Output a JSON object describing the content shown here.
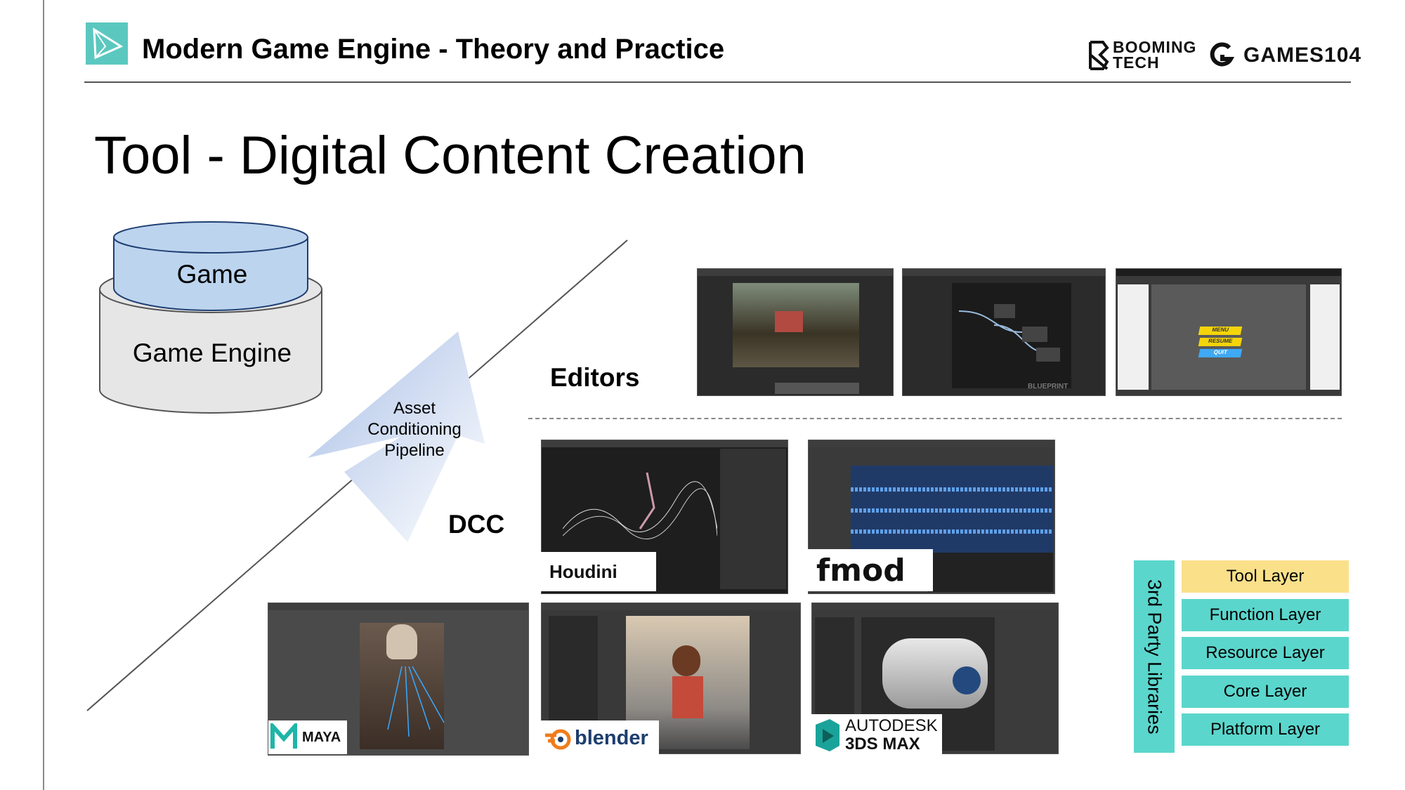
{
  "header": {
    "deck_title": "Modern Game Engine - Theory and Practice",
    "brand_booming": "BOOMING TECH",
    "brand_games": "GAMES104"
  },
  "slide_title": "Tool - Digital Content Creation",
  "stack": {
    "game_label": "Game",
    "engine_label": "Game Engine"
  },
  "pipeline": {
    "line1": "Asset",
    "line2": "Conditioning",
    "line3": "Pipeline"
  },
  "sections": {
    "editors": "Editors",
    "dcc": "DCC"
  },
  "editor_shots": [
    {
      "name": "level-editor"
    },
    {
      "name": "blueprint-editor",
      "caption": "BLUEPRINT"
    },
    {
      "name": "ui-editor",
      "menu": [
        "MENU",
        "RESUME",
        "QUIT"
      ]
    }
  ],
  "dcc_tools": {
    "houdini": "Houdini",
    "fmod": "fmod",
    "maya": "MAYA",
    "blender": "blender",
    "max_line1": "AUTODESK",
    "max_line2": "3DS MAX"
  },
  "layers": {
    "third_party": "3rd Party Libraries",
    "items": [
      {
        "label": "Tool Layer",
        "highlighted": true
      },
      {
        "label": "Function Layer",
        "highlighted": false
      },
      {
        "label": "Resource Layer",
        "highlighted": false
      },
      {
        "label": "Core Layer",
        "highlighted": false
      },
      {
        "label": "Platform Layer",
        "highlighted": false
      }
    ]
  },
  "colors": {
    "teal": "#5bd6cc",
    "tool_highlight": "#fbe08a",
    "game_fill": "#bcd4ee",
    "engine_fill": "#e6e6e6"
  }
}
